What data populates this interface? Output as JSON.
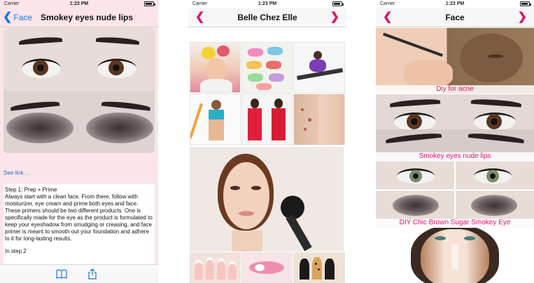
{
  "colors": {
    "accent_pink": "#e0146a",
    "ios_blue": "#1a73e8",
    "panel_pink": "#fbe5e8"
  },
  "phone1": {
    "status_carrier": "Carrier",
    "status_time": "1:23 PM",
    "back_label": "Face",
    "title": "Smokey eyes nude lips",
    "see_link": "See link ...",
    "article_heading": "Step 1: Prep + Prime",
    "article_body": "Always start with a clean face. From there, follow with moisturizer, eye cream and prime both eyes and face. These primers should be two different products. One is specifically made for the eye as the product is formulated to keep your eyeshadow from smudging or creasing, and face primer is meant to smooth out your foundation and adhere to it for long-lasting results.",
    "article_tail": "In step 2",
    "toolbar_icons": [
      "book-icon",
      "share-icon"
    ]
  },
  "phone2": {
    "status_carrier": "Carrier",
    "status_time": "1:23 PM",
    "title": "Belle Chez Elle",
    "tiles": [
      "woman-with-fruit-hat",
      "hair-bows-collection",
      "yoga-stretch",
      "fitness-woman-bands",
      "red-dress-model",
      "acne-skin-before-after",
      "woman-applying-blush",
      "nail-art-french",
      "nail-art-pink",
      "nail-art-leopard"
    ]
  },
  "phone3": {
    "status_carrier": "Carrier",
    "status_time": "1:23 PM",
    "title": "Face",
    "rows": [
      {
        "label": "Diy for acne"
      },
      {
        "label": "Smokey eyes nude lips"
      },
      {
        "label": "DIY Chic Brown Sugar Smokey Eye"
      },
      {
        "label": ""
      }
    ]
  }
}
